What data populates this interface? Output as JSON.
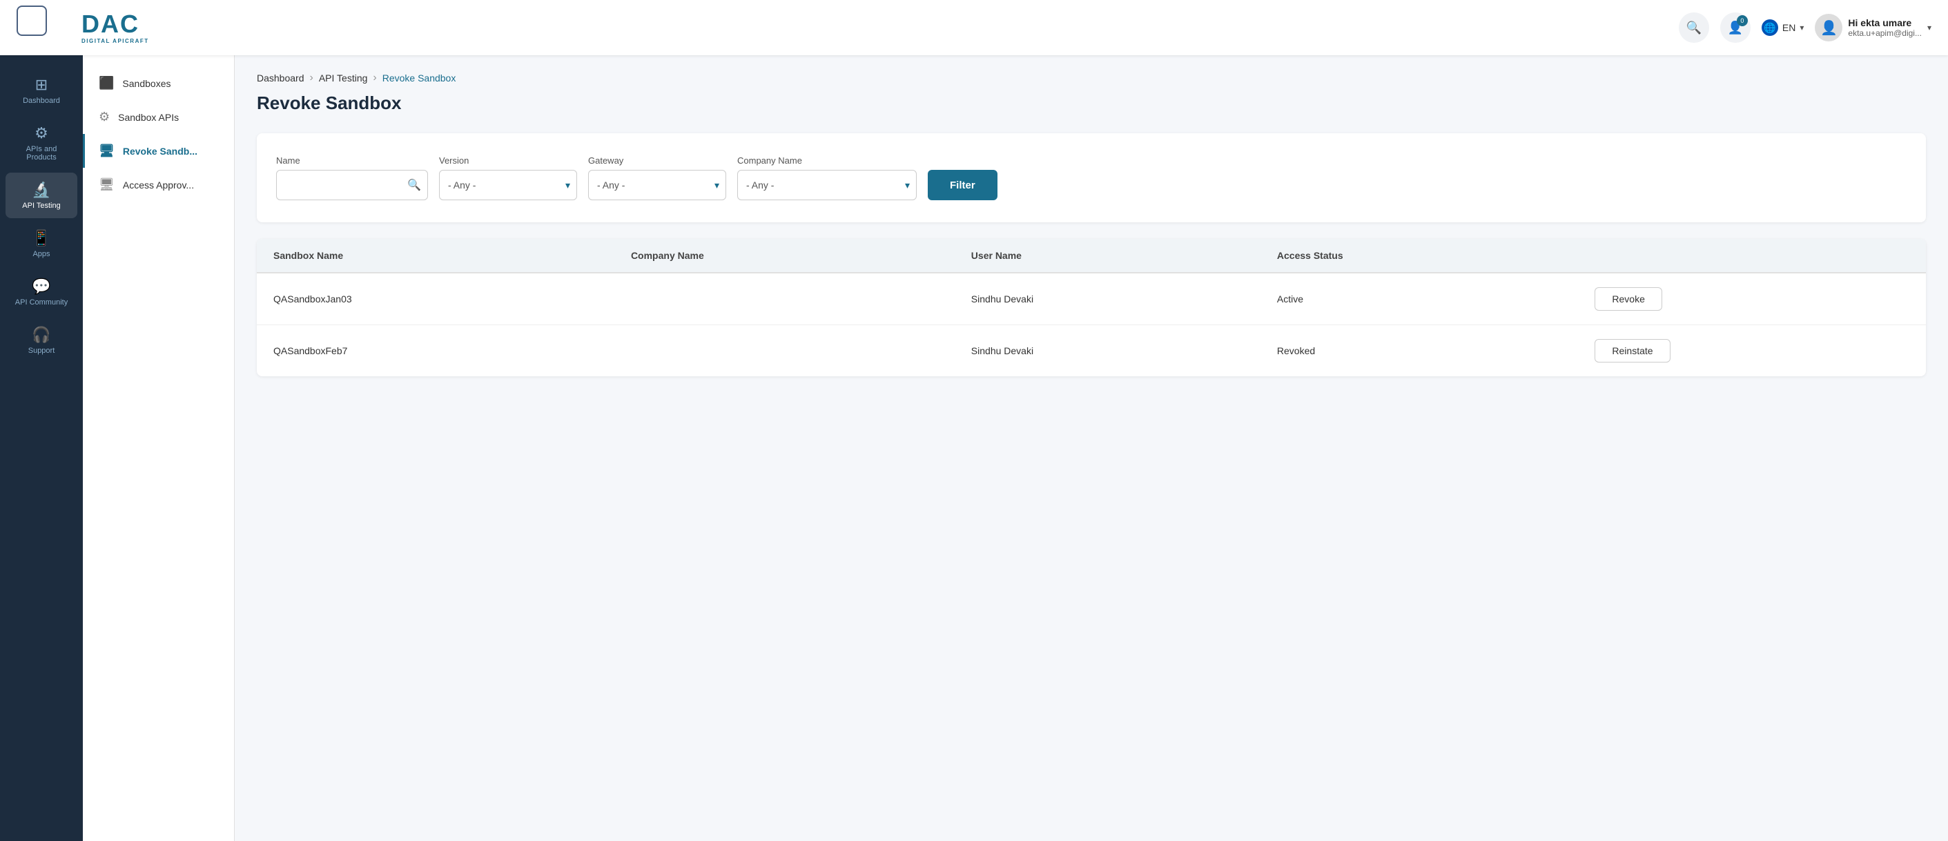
{
  "header": {
    "logo_main": "DAC",
    "logo_sub": "DIGITAL APICRAFT",
    "search_placeholder": "Search",
    "notification_count": "0",
    "lang": "EN",
    "user_name": "Hi ekta umare",
    "user_email": "ekta.u+apim@digi..."
  },
  "sidebar_left": {
    "items": [
      {
        "id": "dashboard",
        "label": "Dashboard",
        "icon": "⊞"
      },
      {
        "id": "apis-products",
        "label": "APIs and Products",
        "icon": "⚙"
      },
      {
        "id": "api-testing",
        "label": "API Testing",
        "icon": "🔬",
        "active": true
      },
      {
        "id": "apps",
        "label": "Apps",
        "icon": "📱"
      },
      {
        "id": "api-community",
        "label": "API Community",
        "icon": "💬"
      },
      {
        "id": "support",
        "label": "Support",
        "icon": "🎧"
      }
    ]
  },
  "sidebar_sub": {
    "items": [
      {
        "id": "sandboxes",
        "label": "Sandboxes",
        "icon": "⬛"
      },
      {
        "id": "sandbox-apis",
        "label": "Sandbox APIs",
        "icon": "⚙"
      },
      {
        "id": "revoke-sandbox",
        "label": "Revoke Sandb...",
        "icon": "🖥",
        "active": true
      },
      {
        "id": "access-approval",
        "label": "Access Approv...",
        "icon": "🖥"
      }
    ]
  },
  "breadcrumb": {
    "items": [
      {
        "label": "Dashboard",
        "active": false
      },
      {
        "label": "API Testing",
        "active": false
      },
      {
        "label": "Revoke Sandbox",
        "active": true
      }
    ]
  },
  "page": {
    "title": "Revoke Sandbox"
  },
  "filters": {
    "name_label": "Name",
    "name_placeholder": "",
    "version_label": "Version",
    "version_value": "- Any -",
    "gateway_label": "Gateway",
    "gateway_value": "- Any -",
    "company_label": "Company Name",
    "company_value": "- Any -",
    "filter_btn": "Filter"
  },
  "table": {
    "columns": [
      "Sandbox Name",
      "Company Name",
      "User Name",
      "Access Status"
    ],
    "rows": [
      {
        "sandbox_name": "QASandboxJan03",
        "company_name": "",
        "user_name": "Sindhu Devaki",
        "access_status": "Active",
        "action_label": "Revoke"
      },
      {
        "sandbox_name": "QASandboxFeb7",
        "company_name": "",
        "user_name": "Sindhu Devaki",
        "access_status": "Revoked",
        "action_label": "Reinstate"
      }
    ]
  }
}
